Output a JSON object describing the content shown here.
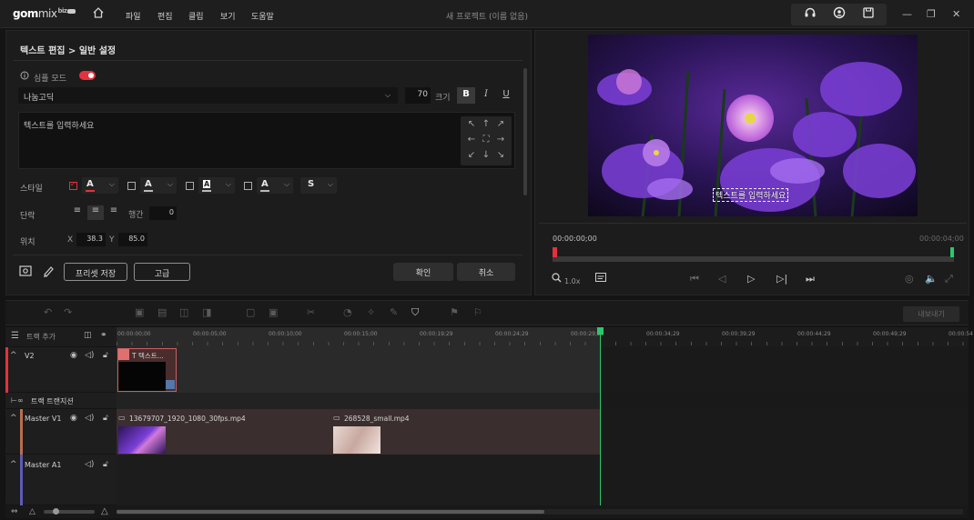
{
  "app": {
    "logo_main": "gom",
    "logo_mix": "mix",
    "logo_biz": "biz",
    "project_title": "새 프로젝트 (이름 없음)"
  },
  "menu": [
    {
      "label": "파일"
    },
    {
      "label": "편집"
    },
    {
      "label": "클립"
    },
    {
      "label": "보기"
    },
    {
      "label": "도움말"
    }
  ],
  "icons": {
    "home": "home-icon",
    "support": "headset-icon",
    "account": "user-circle-icon",
    "save": "save-icon"
  },
  "editor": {
    "breadcrumb": "텍스트 편집 > 일반 설정",
    "mode_label": "심플 모드",
    "mode_on": true,
    "font_name": "나눔고딕",
    "font_size": "70",
    "size_label": "크기",
    "bold": "B",
    "italic": "I",
    "underline": "U",
    "text_value": "텍스트를 입력하세요",
    "style_label": "스타일",
    "style_shadow": "S",
    "paragraph_label": "단락",
    "line_spacing_label": "행간",
    "line_spacing_value": "0",
    "position_label": "위치",
    "pos_x_label": "X",
    "pos_x": "38.3",
    "pos_y_label": "Y",
    "pos_y": "85.0",
    "preset_save": "프리셋 저장",
    "advanced": "고급",
    "confirm": "확인",
    "cancel": "취소"
  },
  "preview": {
    "subtitle": "텍스트를 입력하세요",
    "current_time": "00:00:00;00",
    "total_time": "00:00:04;00",
    "speed": "1.0x"
  },
  "toolbar": {
    "export": "내보내기"
  },
  "timeline": {
    "add_track": "트랙 추가",
    "ruler": [
      "00:00:00;00",
      "00:00:05;00",
      "00:00:10;00",
      "00:00:15;00",
      "00:00:19;29",
      "00:00:24;29",
      "00:00:29;29",
      "00:00:34;29",
      "00:00:39;29",
      "00:00:44;29",
      "00:00:49;29",
      "00:00:54"
    ],
    "tracks": {
      "v2": "V2",
      "transition": "트랙 트랜지션",
      "v1": "Master V1",
      "a1": "Master A1"
    },
    "clips": {
      "text_clip": "T 텍스트...",
      "video1": "13679707_1920_1080_30fps.mp4",
      "video2": "268528_small.mp4"
    }
  },
  "colors": {
    "accent": "#e3313d",
    "playhead": "#29c96a",
    "bg": "#141414"
  }
}
